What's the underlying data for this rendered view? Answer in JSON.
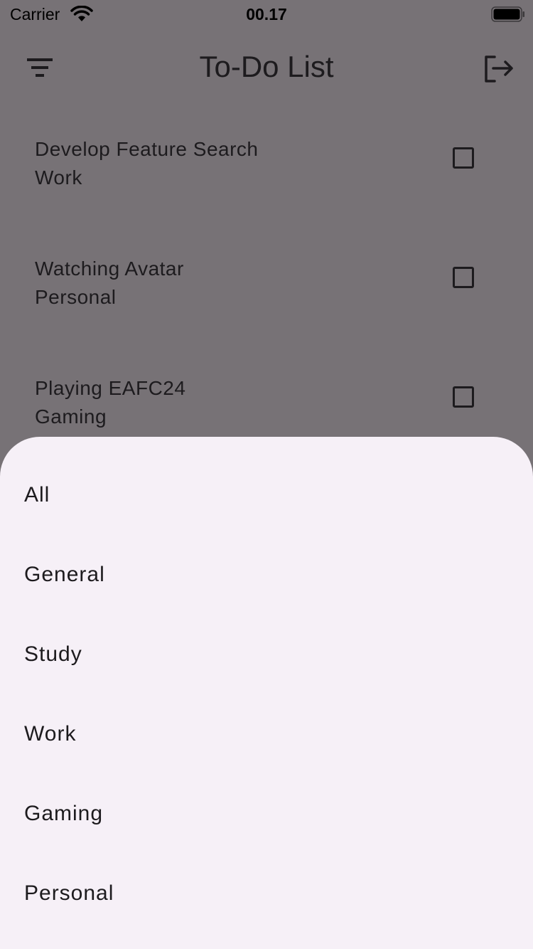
{
  "status_bar": {
    "carrier": "Carrier",
    "time": "00.17"
  },
  "app_bar": {
    "title": "To-Do List",
    "filter_icon": "filter-list-icon",
    "logout_icon": "logout-icon"
  },
  "todos": [
    {
      "title": "Develop Feature Search",
      "category": "Work",
      "checked": false
    },
    {
      "title": "Watching Avatar",
      "category": "Personal",
      "checked": false
    },
    {
      "title": "Playing EAFC24",
      "category": "Gaming",
      "checked": false
    }
  ],
  "filter_sheet": {
    "options": [
      "All",
      "General",
      "Study",
      "Work",
      "Gaming",
      "Personal"
    ]
  },
  "colors": {
    "scrim_background": "#777276",
    "sheet_background": "#f6f0f7",
    "text": "#1d1b1e"
  }
}
